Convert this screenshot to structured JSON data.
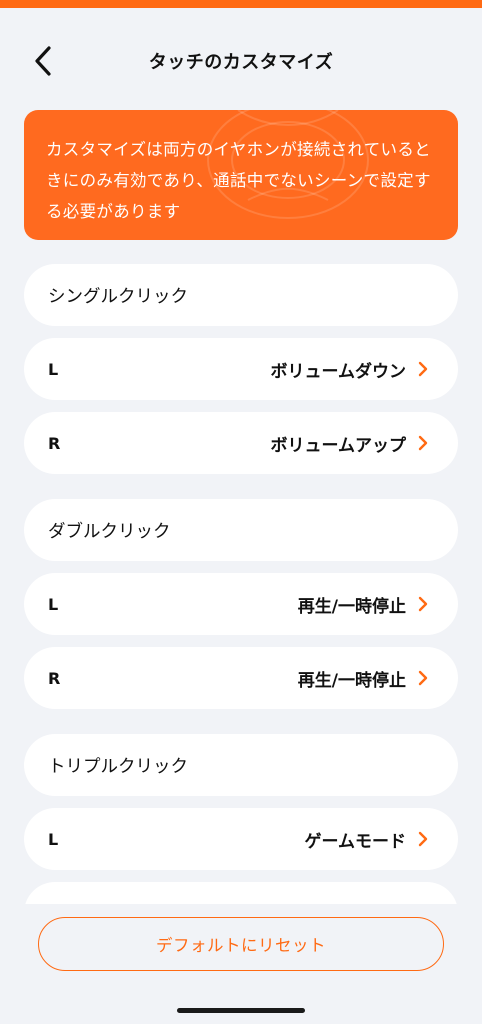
{
  "header": {
    "title": "タッチのカスタマイズ"
  },
  "notice": {
    "text": "カスタマイズは両方のイヤホンが接続されているときにのみ有効であり、通話中でないシーンで設定する必要があります"
  },
  "sections": [
    {
      "title": "シングルクリック",
      "rows": [
        {
          "side": "L",
          "value": "ボリュームダウン"
        },
        {
          "side": "R",
          "value": "ボリュームアップ"
        }
      ]
    },
    {
      "title": "ダブルクリック",
      "rows": [
        {
          "side": "L",
          "value": "再生/一時停止"
        },
        {
          "side": "R",
          "value": "再生/一時停止"
        }
      ]
    },
    {
      "title": "トリプルクリック",
      "rows": [
        {
          "side": "L",
          "value": "ゲームモード"
        }
      ]
    }
  ],
  "footer": {
    "reset_label": "デフォルトにリセット"
  },
  "colors": {
    "accent": "#ff6a13",
    "background": "#f1f3f7",
    "card": "#ffffff"
  }
}
